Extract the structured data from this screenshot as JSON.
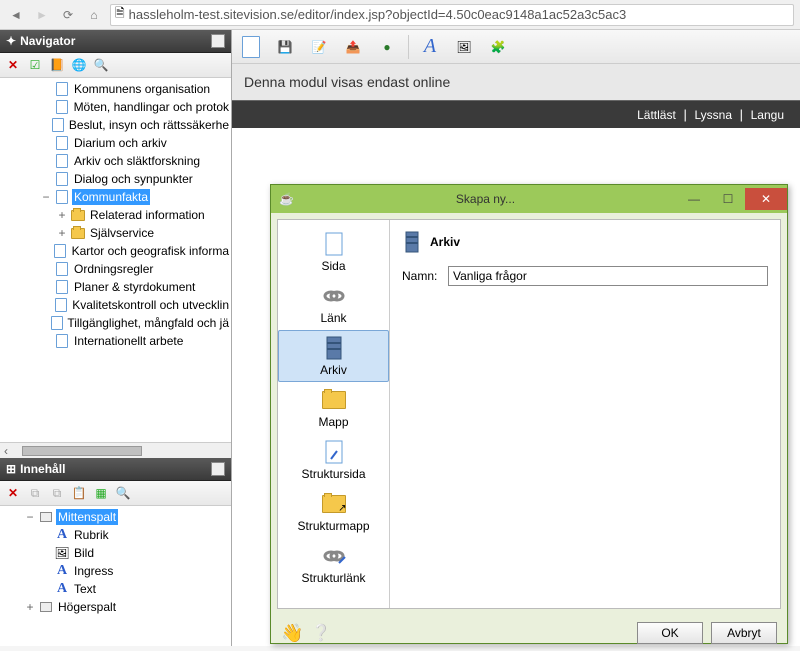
{
  "url": "hassleholm-test.sitevision.se/editor/index.jsp?objectId=4.50c0eac9148a1ac52a3c5ac3",
  "navigator": {
    "title": "Navigator",
    "items": [
      {
        "label": "Kommunens organisation",
        "indent": 2,
        "icon": "page"
      },
      {
        "label": "Möten, handlingar och protok",
        "indent": 2,
        "icon": "page"
      },
      {
        "label": "Beslut, insyn och rättssäkerhe",
        "indent": 2,
        "icon": "page"
      },
      {
        "label": "Diarium och arkiv",
        "indent": 2,
        "icon": "page"
      },
      {
        "label": "Arkiv och släktforskning",
        "indent": 2,
        "icon": "page"
      },
      {
        "label": "Dialog och synpunkter",
        "indent": 2,
        "icon": "page"
      },
      {
        "label": "Kommunfakta",
        "indent": 2,
        "icon": "page",
        "twisty": "−",
        "selected": true
      },
      {
        "label": "Relaterad information",
        "indent": 3,
        "icon": "folder",
        "twisty": "+"
      },
      {
        "label": "Självservice",
        "indent": 3,
        "icon": "folder",
        "twisty": "+"
      },
      {
        "label": "Kartor och geografisk informa",
        "indent": 2,
        "icon": "page"
      },
      {
        "label": "Ordningsregler",
        "indent": 2,
        "icon": "page"
      },
      {
        "label": "Planer & styrdokument",
        "indent": 2,
        "icon": "page"
      },
      {
        "label": "Kvalitetskontroll och utvecklin",
        "indent": 2,
        "icon": "page"
      },
      {
        "label": "Tillgänglighet, mångfald och jä",
        "indent": 2,
        "icon": "page"
      },
      {
        "label": "Internationellt arbete",
        "indent": 2,
        "icon": "page"
      }
    ]
  },
  "innehall": {
    "title": "Innehåll",
    "items": [
      {
        "label": "Mittenspalt",
        "indent": 0,
        "twisty": "−",
        "selected": true,
        "icon": "panel"
      },
      {
        "label": "Rubrik",
        "indent": 1,
        "icon": "A"
      },
      {
        "label": "Bild",
        "indent": 1,
        "icon": "img"
      },
      {
        "label": "Ingress",
        "indent": 1,
        "icon": "A"
      },
      {
        "label": "Text",
        "indent": 1,
        "icon": "A"
      },
      {
        "label": "Högerspalt",
        "indent": 0,
        "twisty": "+",
        "icon": "panel"
      }
    ]
  },
  "banner": "Denna modul visas endast online",
  "topnav": {
    "lattlast": "Lättläst",
    "lyssna": "Lyssna",
    "lang": "Langu"
  },
  "dialog": {
    "title": "Skapa ny...",
    "types": [
      {
        "label": "Sida"
      },
      {
        "label": "Länk"
      },
      {
        "label": "Arkiv",
        "selected": true
      },
      {
        "label": "Mapp"
      },
      {
        "label": "Struktursida"
      },
      {
        "label": "Strukturmapp"
      },
      {
        "label": "Strukturlänk"
      }
    ],
    "form_header": "Arkiv",
    "name_label": "Namn:",
    "name_value": "Vanliga frågor",
    "ok": "OK",
    "cancel": "Avbryt"
  }
}
